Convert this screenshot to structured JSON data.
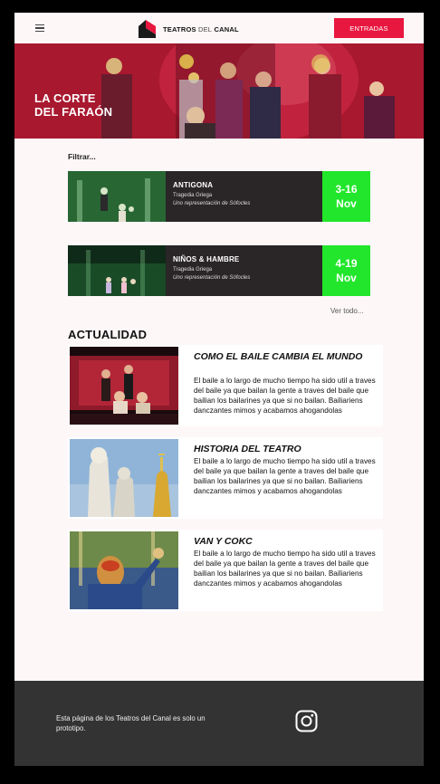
{
  "header": {
    "logo_brand": "TEATROS",
    "logo_middle": "DEL",
    "logo_end": "CANAL",
    "cta_label": "ENTRADAS",
    "menu_icon": "hamburger-menu-icon",
    "accent_color": "#e8173f"
  },
  "hero": {
    "title_line1": "LA CORTE",
    "title_line2": "DEL FARAÓN"
  },
  "filter": {
    "label": "Filtrar..."
  },
  "shows": [
    {
      "title": "ANTIGONA",
      "genre": "Tragedia Griega",
      "credit": "Uno representación de Sófocles",
      "date_range": "3-16",
      "month": "Nov"
    },
    {
      "title": "NIÑOS & HAMBRE",
      "genre": "Tragedia Griega",
      "credit": "Uno representación de Sófocles",
      "date_range": "4-19",
      "month": "Nov"
    }
  ],
  "see_all_label": "Ver todo...",
  "news": {
    "heading": "ACTUALIDAD",
    "items": [
      {
        "title": "COMO EL BAILE CAMBIA EL MUNDO",
        "body": "El baile a lo largo de mucho tiempo ha sido util a traves del baile ya que bailan la gente a traves del baile que bailian los bailarines ya que si no bailan. Bailiariens danczantes mimos y acabamos ahogandolas"
      },
      {
        "title": "HISTORIA DEL TEATRO",
        "body": "El baile a lo largo de mucho tiempo ha sido util a traves del baile ya que bailan la gente a traves del baile que bailian los bailarines ya que si no bailan. Bailiariens danczantes mimos y acabamos ahogandolas"
      },
      {
        "title": "VAN Y COKC",
        "body": "El baile a lo largo de mucho tiempo ha sido util a traves del baile ya que bailan la gente a traves del baile que bailian los bailarines ya que si no bailan. Bailiariens danczantes mimos y acabamos ahogandolas"
      }
    ]
  },
  "footer": {
    "text": "Esta página de los Teatros del Canal es solo un prototipo.",
    "social_icon": "instagram-icon"
  },
  "colors": {
    "date_badge": "#22e62b",
    "card_bg": "#2a2526",
    "footer_bg": "#333333"
  }
}
